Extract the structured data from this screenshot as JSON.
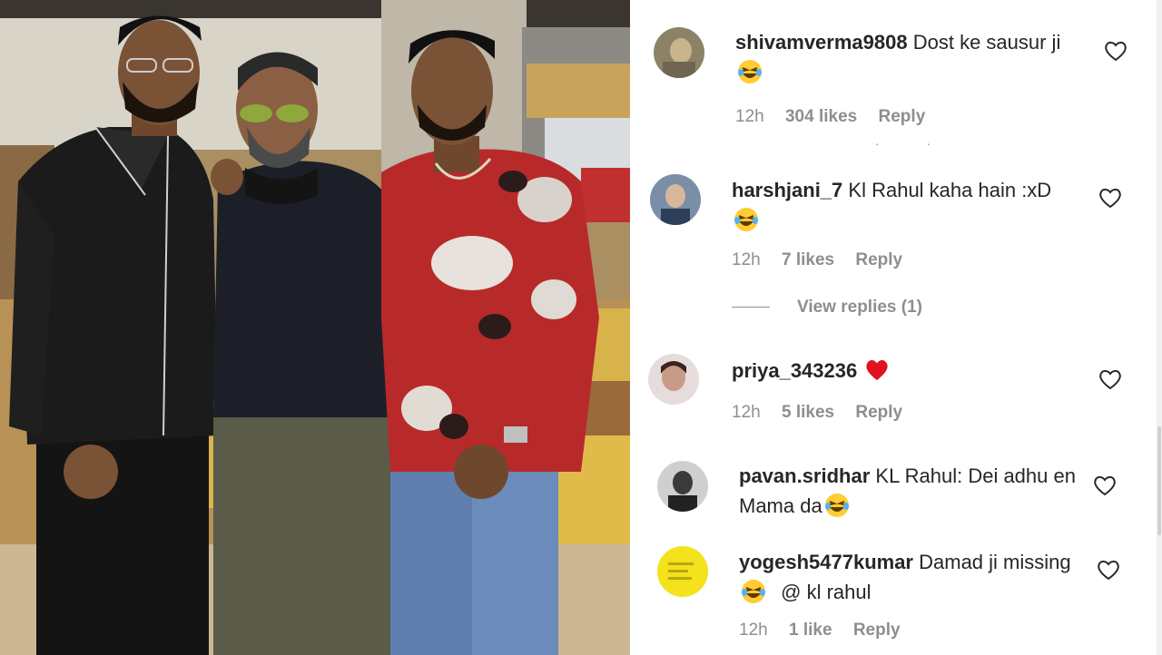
{
  "photo": {
    "description_icon": "photo-three-men"
  },
  "comments": [
    {
      "username": "shivamverma9808",
      "text": "Dost ke sausur ji",
      "emoji": "laughing-emoji",
      "time": "12h",
      "likes": "304 likes",
      "reply": "Reply"
    },
    {
      "username": "harshjani_7",
      "text": "Kl Rahul kaha hain :xD",
      "emoji": "laughing-emoji",
      "time": "12h",
      "likes": "7 likes",
      "reply": "Reply",
      "view_replies": "View replies (1)"
    },
    {
      "username": "priya_343236",
      "text": "",
      "emoji": "red-heart-emoji",
      "time": "12h",
      "likes": "5 likes",
      "reply": "Reply"
    },
    {
      "username": "pavan.sridhar",
      "text": "KL Rahul: Dei adhu en Mama da",
      "emoji": "laughing-emoji"
    },
    {
      "username": "yogesh5477kumar",
      "text": "Damad ji missing",
      "emoji": "laughing-emoji",
      "text_after": "@ kl rahul",
      "time": "12h",
      "likes": "1 like",
      "reply": "Reply"
    }
  ],
  "colors": {
    "text": "#262626",
    "meta": "#8e8e8e",
    "heart_red": "#ed4956"
  }
}
